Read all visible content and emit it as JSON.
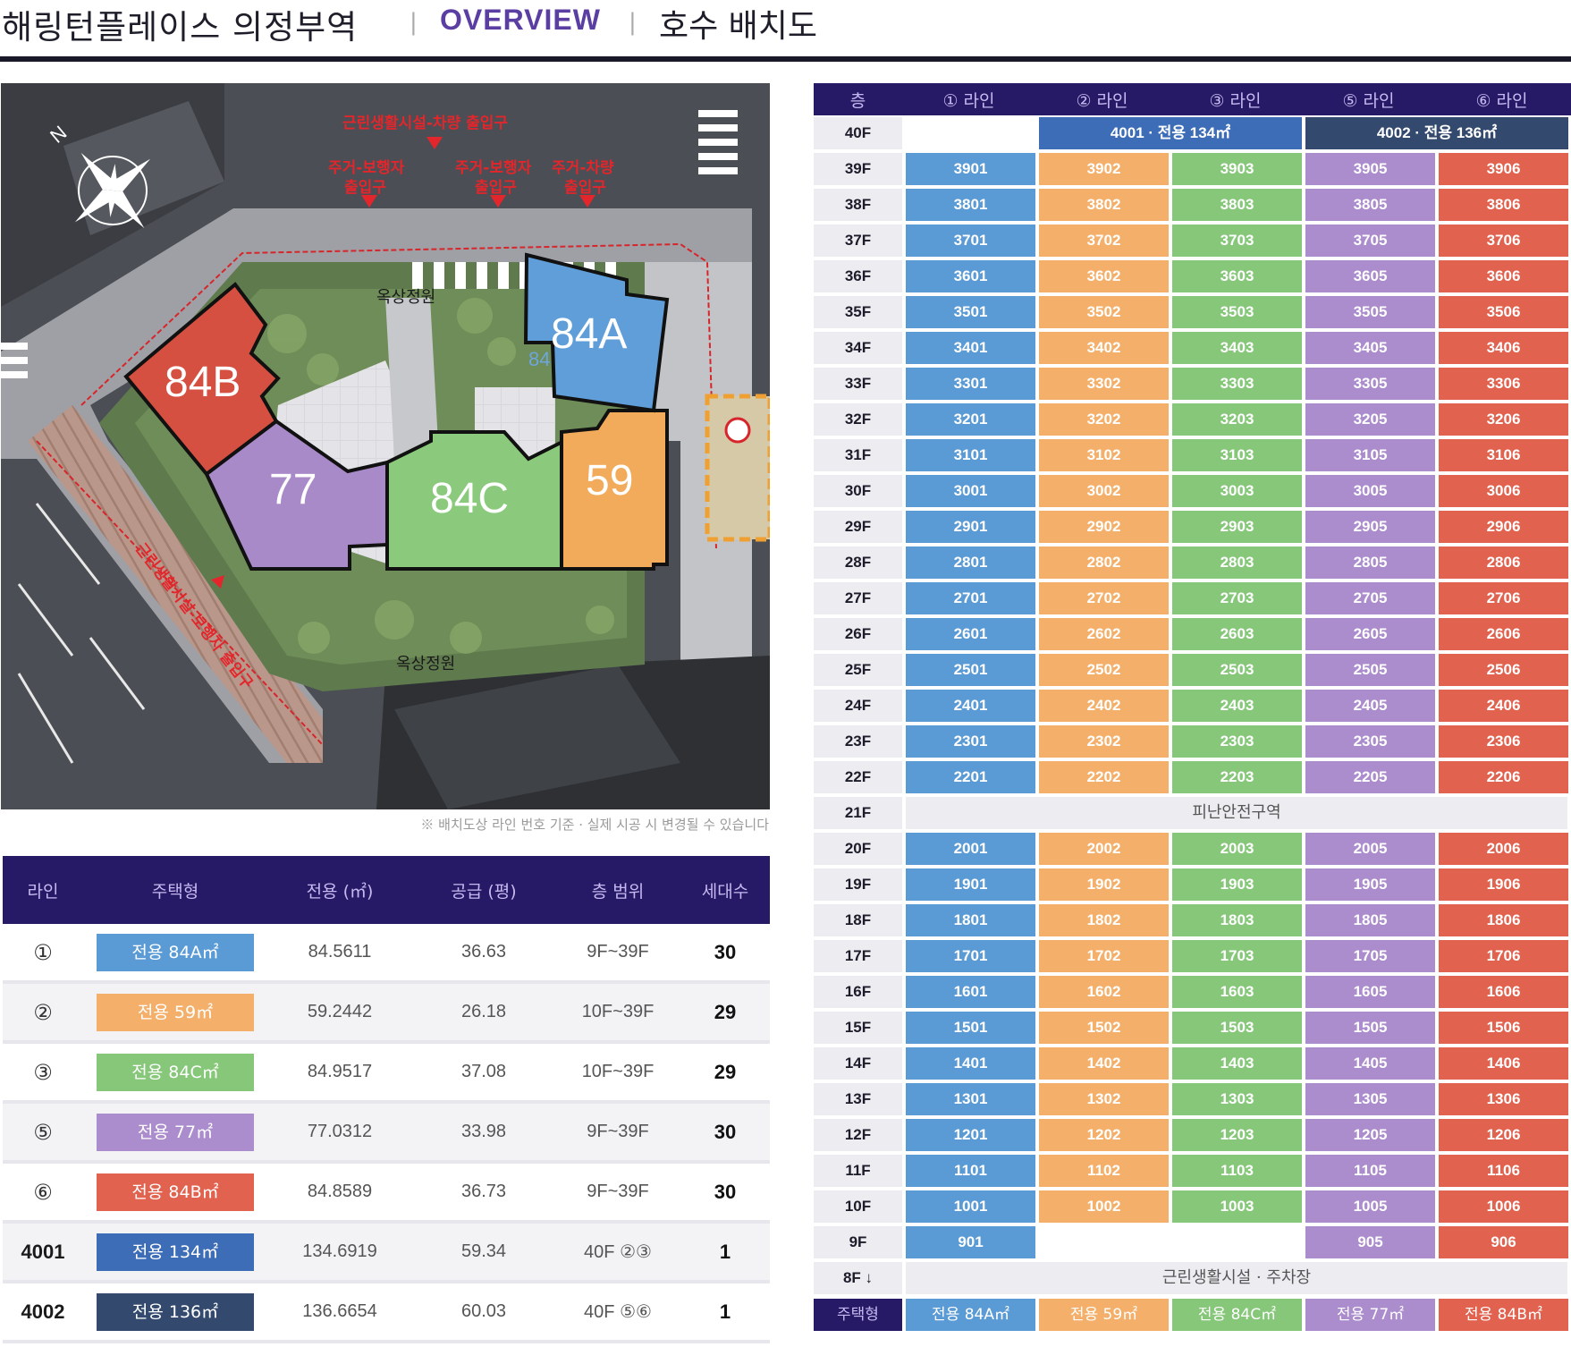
{
  "header": {
    "title": "해링턴플레이스 의정부역",
    "sep1": "|",
    "overview": "OVERVIEW",
    "sep2": "|",
    "subtitle": "호수 배치도"
  },
  "colors": {
    "line1": "#5b9bd5",
    "line2": "#f4b06a",
    "line3": "#86c77a",
    "line5": "#ab8ccc",
    "line6": "#e0624f",
    "u4001": "#3e6db8",
    "u4002": "#33496e",
    "header_bg": "#261a66"
  },
  "site_plan": {
    "labels": {
      "entrance_top": "근린생활시설-차량 출입구",
      "entrance_resident_ped": [
        "주거-보행자",
        "출입구"
      ],
      "entrance_resident_ped2": [
        "주거-보행자",
        "출입구"
      ],
      "entrance_resident_car": [
        "주거-차량",
        "출입구"
      ],
      "garden_top": "옥상정원",
      "garden_bottom": "옥상정원",
      "entrance_side": "근린생활시설-보행자 출입구",
      "compass_n": "N",
      "bldg_84a": "84A",
      "bldg_84b": "84B",
      "bldg_77": "77",
      "bldg_84c": "84C",
      "bldg_59": "59",
      "ghost_84": "84"
    },
    "caption": "※ 배치도상 라인 번호 기준 · 실제 시공 시 변경될 수 있습니다"
  },
  "summary": {
    "headers": [
      "라인",
      "주택형",
      "전용 (㎡)",
      "공급 (평)",
      "층 범위",
      "세대수"
    ],
    "rows": [
      {
        "line": "①",
        "type": "전용 84A㎡",
        "area": "84.5611",
        "supply": "36.63",
        "floors": "9F~39F",
        "count": "30",
        "color": "#5b9bd5"
      },
      {
        "line": "②",
        "type": "전용 59㎡",
        "area": "59.2442",
        "supply": "26.18",
        "floors": "10F~39F",
        "count": "29",
        "color": "#f4b06a"
      },
      {
        "line": "③",
        "type": "전용 84C㎡",
        "area": "84.9517",
        "supply": "37.08",
        "floors": "10F~39F",
        "count": "29",
        "color": "#86c77a"
      },
      {
        "line": "⑤",
        "type": "전용 77㎡",
        "area": "77.0312",
        "supply": "33.98",
        "floors": "9F~39F",
        "count": "30",
        "color": "#ab8ccc"
      },
      {
        "line": "⑥",
        "type": "전용 84B㎡",
        "area": "84.8589",
        "supply": "36.73",
        "floors": "9F~39F",
        "count": "30",
        "color": "#e0624f"
      },
      {
        "line": "4001",
        "type": "전용 134㎡",
        "area": "134.6919",
        "supply": "59.34",
        "floors": "40F ②③",
        "count": "1",
        "color": "#3e6db8"
      },
      {
        "line": "4002",
        "type": "전용 136㎡",
        "area": "136.6654",
        "supply": "60.03",
        "floors": "40F ⑤⑥",
        "count": "1",
        "color": "#33496e"
      }
    ]
  },
  "grid": {
    "headers": {
      "floor": "층",
      "l1": "① 라인",
      "l2": "② 라인",
      "l3": "③ 라인",
      "l5": "⑤ 라인",
      "l6": "⑥ 라인"
    },
    "penthouse": {
      "floor": "40F",
      "u4001": "4001  ·  전용 134㎡",
      "u4002": "4002  ·  전용 136㎡"
    },
    "floors_upper": [
      "39",
      "38",
      "37",
      "36",
      "35",
      "34",
      "33",
      "32",
      "31",
      "30",
      "29",
      "28",
      "27",
      "26",
      "25",
      "24",
      "23",
      "22"
    ],
    "refuge": {
      "floor": "21F",
      "label": "피난안전구역"
    },
    "floors_lower": [
      "20",
      "19",
      "18",
      "17",
      "16",
      "15",
      "14",
      "13",
      "12",
      "11",
      "10"
    ],
    "floor9": {
      "floor": "9F",
      "u1": "901",
      "u5": "905",
      "u6": "906"
    },
    "floor8": {
      "floor": "8F ↓",
      "label": "근린생활시설 · 주차장"
    },
    "footer": {
      "label": "주택형",
      "t1": "전용 84A㎡",
      "t2": "전용 59㎡",
      "t3": "전용 84C㎡",
      "t5": "전용 77㎡",
      "t6": "전용 84B㎡"
    }
  }
}
